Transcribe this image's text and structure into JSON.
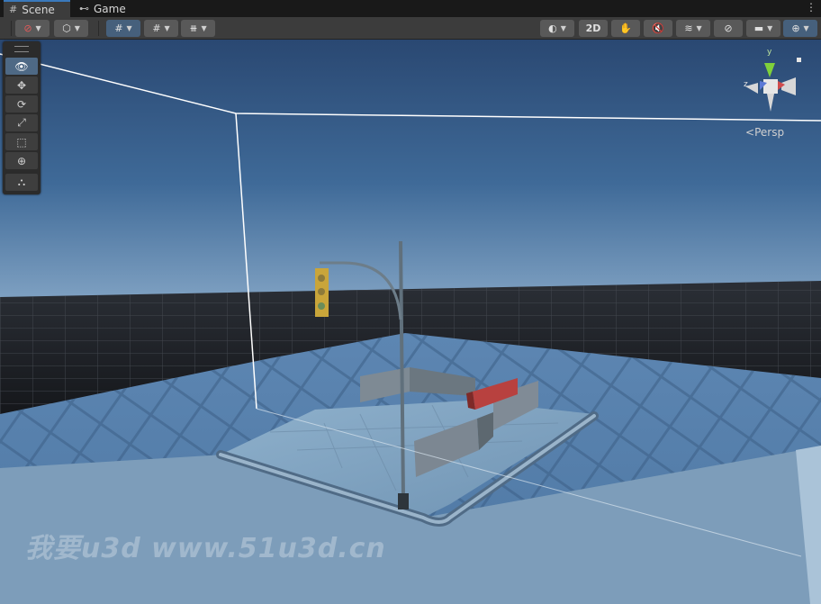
{
  "tabs": [
    {
      "label": "Scene",
      "icon": "grid-icon",
      "active": true
    },
    {
      "label": "Game",
      "icon": "gamepad-icon",
      "active": false
    }
  ],
  "toolbar": {
    "two_d_label": "2D"
  },
  "tools": [
    {
      "name": "view-tool",
      "icon": "eye-icon",
      "glyph": "👁",
      "selected": true
    },
    {
      "name": "move-tool",
      "icon": "move-icon",
      "glyph": "✥",
      "selected": false
    },
    {
      "name": "rotate-tool",
      "icon": "rotate-icon",
      "glyph": "⟳",
      "selected": false
    },
    {
      "name": "scale-tool",
      "icon": "scale-icon",
      "glyph": "⤢",
      "selected": false
    },
    {
      "name": "rect-tool",
      "icon": "rect-icon",
      "glyph": "⬚",
      "selected": false
    },
    {
      "name": "transform-tool",
      "icon": "transform-icon",
      "glyph": "⊕",
      "selected": false
    },
    {
      "name": "custom-tool",
      "icon": "custom-tool-icon",
      "glyph": "⛬",
      "selected": false
    }
  ],
  "gizmo": {
    "projection_label": "Persp",
    "axis_labels": {
      "y": "y",
      "z": "z"
    }
  },
  "watermark": "我要u3d  www.51u3d.cn",
  "colors": {
    "accent": "#3a79bb",
    "sky_top": "#2a4a74",
    "horizon": "#6f93b6",
    "ground": "#5a82ad"
  }
}
